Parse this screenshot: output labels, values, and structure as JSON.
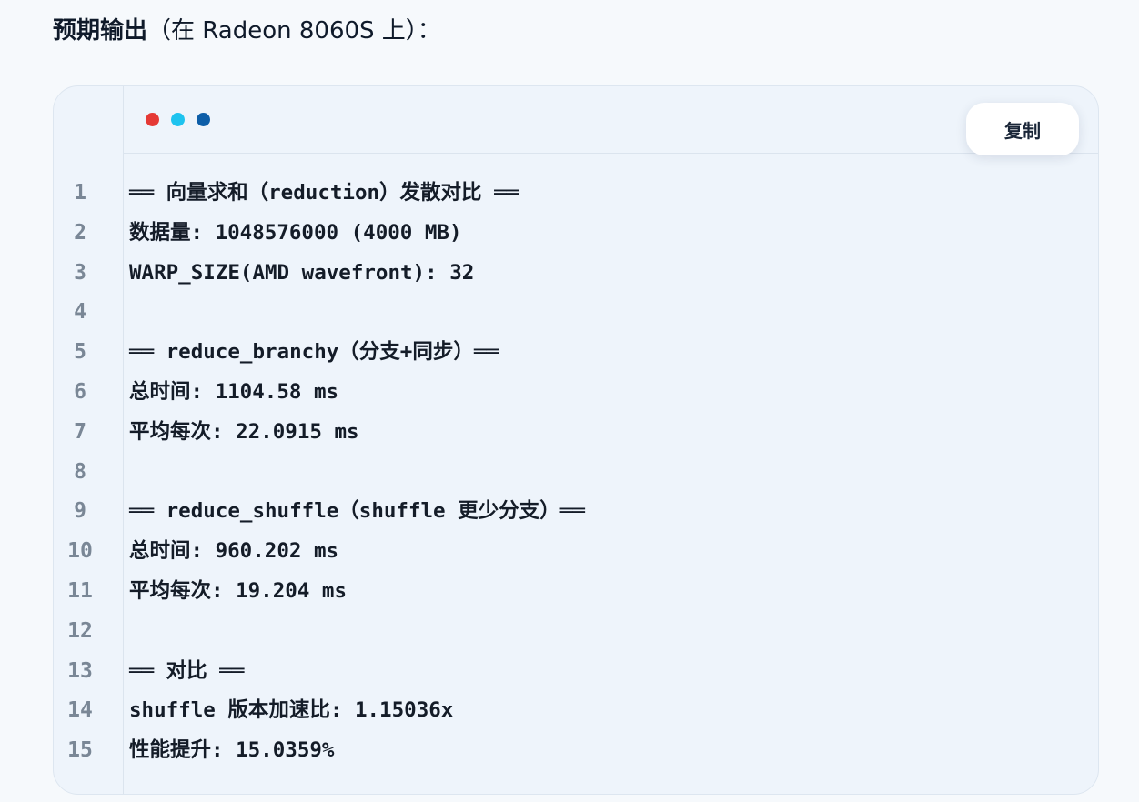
{
  "heading": {
    "strong": "预期输出",
    "rest": "（在 Radeon 8060S 上）："
  },
  "code_block": {
    "copy_label": "复制",
    "window_dots": [
      {
        "name": "red-dot",
        "color": "#e53935"
      },
      {
        "name": "cyan-dot",
        "color": "#1ec3ef"
      },
      {
        "name": "blue-dot",
        "color": "#0d5ea8"
      }
    ],
    "lines": [
      {
        "number": "1",
        "text": "══ 向量求和（reduction）发散对比 ══"
      },
      {
        "number": "2",
        "text": "数据量: 1048576000 (4000 MB)"
      },
      {
        "number": "3",
        "text": "WARP_SIZE(AMD wavefront): 32"
      },
      {
        "number": "4",
        "text": ""
      },
      {
        "number": "5",
        "text": "══ reduce_branchy（分支+同步）══"
      },
      {
        "number": "6",
        "text": "总时间: 1104.58 ms"
      },
      {
        "number": "7",
        "text": "平均每次: 22.0915 ms"
      },
      {
        "number": "8",
        "text": ""
      },
      {
        "number": "9",
        "text": "══ reduce_shuffle（shuffle 更少分支）══"
      },
      {
        "number": "10",
        "text": "总时间: 960.202 ms"
      },
      {
        "number": "11",
        "text": "平均每次: 19.204 ms"
      },
      {
        "number": "12",
        "text": ""
      },
      {
        "number": "13",
        "text": "══ 对比 ══"
      },
      {
        "number": "14",
        "text": "shuffle 版本加速比: 1.15036x"
      },
      {
        "number": "15",
        "text": "性能提升: 15.0359%"
      }
    ]
  }
}
